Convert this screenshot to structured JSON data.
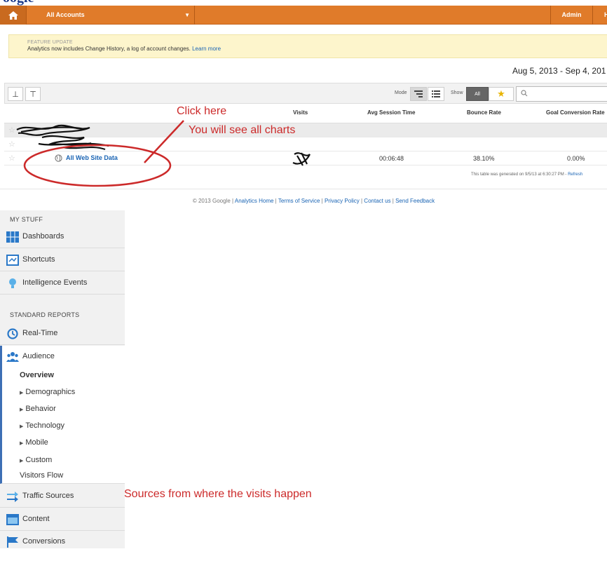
{
  "topbar": {
    "accounts_label": "All Accounts",
    "admin_label": "Admin",
    "help_label": "H"
  },
  "banner": {
    "title": "FEATURE UPDATE",
    "text": "Analytics now includes Change History, a log of account changes.",
    "link": "Learn more"
  },
  "date_range": "Aug 5, 2013 - Sep 4, 201",
  "toolbar": {
    "mode_label": "Mode",
    "show_label": "Show",
    "show_all": "All",
    "search_placeholder": ""
  },
  "table": {
    "columns": [
      "Visits",
      "Avg Session Time",
      "Bounce Rate",
      "Goal Conversion Rate"
    ],
    "rows": [
      {
        "name": "",
        "visits": "",
        "avg_session": "",
        "bounce": "",
        "conversion": ""
      },
      {
        "name": "",
        "visits": "",
        "avg_session": "",
        "bounce": "",
        "conversion": ""
      },
      {
        "name": "All Web Site Data",
        "visits": "",
        "avg_session": "00:06:48",
        "bounce": "38.10%",
        "conversion": "0.00%"
      }
    ],
    "generated_text": "This table was generated on 9/5/13 at 6:30:27 PM -",
    "refresh": "Refresh"
  },
  "footer": {
    "copyright": "© 2013 Google |",
    "links": [
      "Analytics Home",
      "Terms of Service",
      "Privacy Policy",
      "Contact us",
      "Send Feedback"
    ],
    "sep": "|"
  },
  "sidebar": {
    "my_stuff": "MY STUFF",
    "standard_reports": "STANDARD REPORTS",
    "items": [
      {
        "label": "Dashboards",
        "icon": "dashboards-icon"
      },
      {
        "label": "Shortcuts",
        "icon": "shortcuts-icon"
      },
      {
        "label": "Intelligence Events",
        "icon": "lightbulb-icon"
      },
      {
        "label": "Real-Time",
        "icon": "realtime-icon"
      },
      {
        "label": "Audience",
        "icon": "audience-icon"
      },
      {
        "label": "Traffic Sources",
        "icon": "traffic-sources-icon"
      },
      {
        "label": "Content",
        "icon": "content-icon"
      },
      {
        "label": "Conversions",
        "icon": "flag-icon"
      }
    ],
    "audience_sub": [
      "Overview",
      "Demographics",
      "Behavior",
      "Technology",
      "Mobile",
      "Custom",
      "Visitors Flow"
    ]
  },
  "annotations": {
    "click_here": "Click here",
    "see_charts": "You will see all charts",
    "sources": "Sources from where the visits happen"
  },
  "colors": {
    "topbar": "#e07b2a",
    "banner": "#fdf5cc",
    "link": "#1a64b4",
    "annotation": "#cc2a2a",
    "sidebar": "#f1f1f1"
  }
}
